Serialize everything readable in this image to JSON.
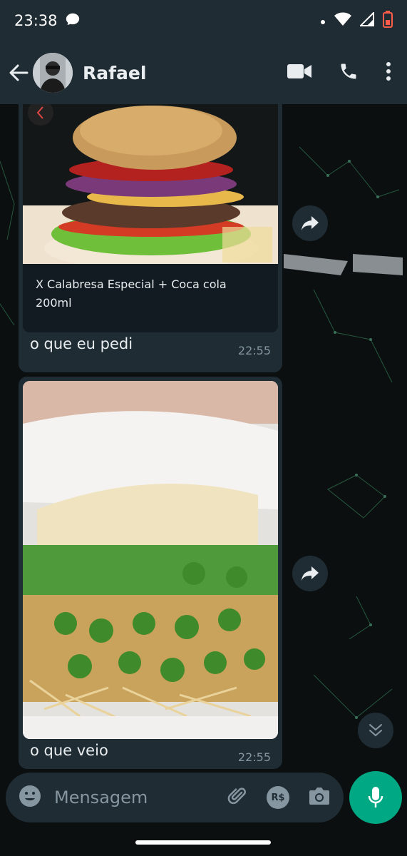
{
  "status_bar": {
    "time": "23:38"
  },
  "header": {
    "contact_name": "Rafael",
    "icons": [
      "back-arrow-icon",
      "video-call-icon",
      "phone-icon",
      "more-vert-icon"
    ]
  },
  "messages": [
    {
      "type": "link_preview",
      "preview_title": "X Calabresa Especial + Coca cola 200ml",
      "caption": "o que eu pedi",
      "time": "22:55"
    },
    {
      "type": "image",
      "caption": "o que veio",
      "time": "22:55"
    }
  ],
  "input": {
    "placeholder": "Mensagem",
    "icons": [
      "emoji-icon",
      "attach-icon",
      "payment-icon",
      "camera-icon",
      "mic-icon"
    ],
    "payment_label": "R$"
  },
  "colors": {
    "header_bg": "#1f2c34",
    "bubble_bg": "#1f2c34",
    "chat_bg": "#0b0f10",
    "accent": "#00a884",
    "text_secondary": "#8696a0"
  }
}
